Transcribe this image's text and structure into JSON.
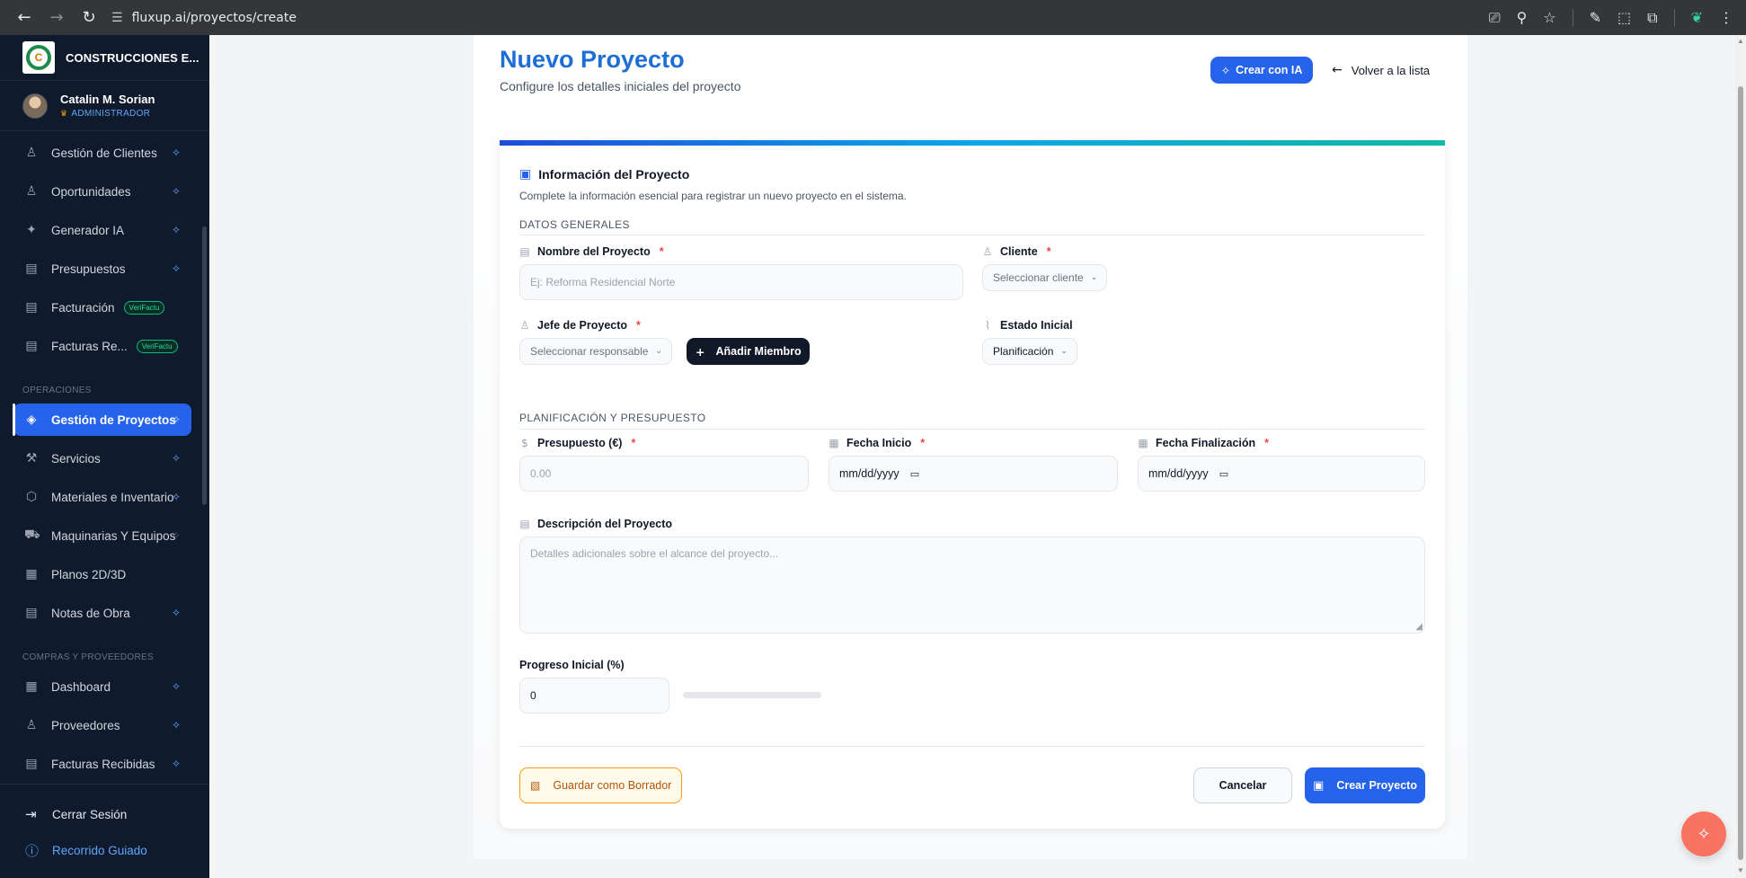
{
  "browser": {
    "url": "fluxup.ai/proyectos/create",
    "icons": [
      "back-icon",
      "forward-icon",
      "reload-icon",
      "site-settings-icon",
      "install-icon",
      "zoom-icon",
      "bookmark-star-icon",
      "extension-icon",
      "screenshot-icon",
      "extensions-icon",
      "feather-icon",
      "menu-icon"
    ]
  },
  "sidebar": {
    "brand": "CONSTRUCCIONES E...",
    "user": {
      "name": "Catalin M. Sorian",
      "role": "ADMINISTRADOR"
    },
    "items": [
      {
        "label": "Gestión de Clientes",
        "icon": "user-icon",
        "spark": true
      },
      {
        "label": "Oportunidades",
        "icon": "users-icon",
        "spark": true
      },
      {
        "label": "Generador IA",
        "icon": "sparkles-icon",
        "spark": true
      },
      {
        "label": "Presupuestos",
        "icon": "document-icon",
        "spark": true
      },
      {
        "label": "Facturación",
        "icon": "invoice-icon",
        "badge": "VeriFactu"
      },
      {
        "label": "Facturas Re...",
        "icon": "invoice-icon",
        "badge": "VeriFactu"
      }
    ],
    "section_operaciones": "OPERACIONES",
    "operaciones": [
      {
        "label": "Gestión de Proyectos",
        "icon": "blueprint-icon",
        "active": true
      },
      {
        "label": "Servicios",
        "icon": "wrench-icon"
      },
      {
        "label": "Materiales e Inventario",
        "icon": "box-icon"
      },
      {
        "label": "Maquinarias Y Equipos",
        "icon": "truck-icon"
      },
      {
        "label": "Planos 2D/3D",
        "icon": "grid-icon"
      },
      {
        "label": "Notas de Obra",
        "icon": "notes-icon"
      }
    ],
    "section_compras": "COMPRAS Y PROVEEDORES",
    "compras": [
      {
        "label": "Dashboard",
        "icon": "grid-icon"
      },
      {
        "label": "Proveedores",
        "icon": "users-icon"
      },
      {
        "label": "Facturas Recibidas",
        "icon": "invoice-icon"
      }
    ],
    "logout": "Cerrar Sesión",
    "guided_tour": "Recorrido Guiado"
  },
  "header": {
    "title": "Nuevo Proyecto",
    "subtitle": "Configure los detalles iniciales del proyecto",
    "ai_button": "Crear con IA",
    "back_link": "Volver a la lista"
  },
  "form": {
    "card_title": "Información del Proyecto",
    "card_description": "Complete la información esencial para registrar un nuevo proyecto en el sistema.",
    "section_general": "DATOS GENERALES",
    "project_name": {
      "label": "Nombre del Proyecto",
      "placeholder": "Ej: Reforma Residencial Norte"
    },
    "client": {
      "label": "Cliente",
      "placeholder": "Seleccionar cliente"
    },
    "manager": {
      "label": "Jefe de Proyecto",
      "placeholder": "Seleccionar responsable"
    },
    "add_member": "Añadir Miembro",
    "initial_status": {
      "label": "Estado Inicial",
      "value": "Planificación"
    },
    "section_planning": "PLANIFICACIÓN Y PRESUPUESTO",
    "budget": {
      "label": "Presupuesto (€)",
      "placeholder": "0.00"
    },
    "start_date": {
      "label": "Fecha Inicio",
      "value": "mm/dd/yyyy"
    },
    "end_date": {
      "label": "Fecha Finalización",
      "value": "mm/dd/yyyy"
    },
    "description": {
      "label": "Descripción del Proyecto",
      "placeholder": "Detalles adicionales sobre el alcance del proyecto..."
    },
    "progress": {
      "label": "Progreso Inicial (%)",
      "value": "0",
      "fraction": 0
    },
    "save_draft": "Guardar como Borrador",
    "cancel": "Cancelar",
    "create": "Crear Proyecto"
  },
  "colors": {
    "primary": "#2563eb",
    "title_blue": "#1d6fd6",
    "sidebar_bg": "#0f1b2d",
    "draft_border": "#f59e0b",
    "fab": "#f97362",
    "required": "#ef4444"
  }
}
